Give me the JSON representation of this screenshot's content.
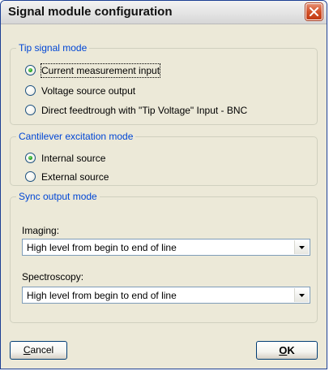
{
  "window": {
    "title": "Signal module configuration",
    "close_icon": "close-x-icon"
  },
  "tip_signal": {
    "legend": "Tip signal mode",
    "options": [
      {
        "label": "Current measurement input",
        "selected": true
      },
      {
        "label": "Voltage source output",
        "selected": false
      },
      {
        "label": "Direct feedtrough with \"Tip Voltage\" Input - BNC",
        "selected": false
      }
    ]
  },
  "cantilever": {
    "legend": "Cantilever excitation mode",
    "options": [
      {
        "label": "Internal source",
        "selected": true
      },
      {
        "label": "External source",
        "selected": false
      }
    ]
  },
  "sync": {
    "legend": "Sync output mode",
    "imaging_label": "Imaging:",
    "imaging_value": "High level from begin to end of line",
    "spectroscopy_label": "Spectroscopy:",
    "spectroscopy_value": "High level from begin to end of line"
  },
  "buttons": {
    "cancel_first": "C",
    "cancel_rest": "ancel",
    "ok_first": "O",
    "ok_rest": "K"
  },
  "colors": {
    "legend": "#0046d5",
    "radio_dot": "#21a121",
    "close_button": "#d3522a"
  }
}
